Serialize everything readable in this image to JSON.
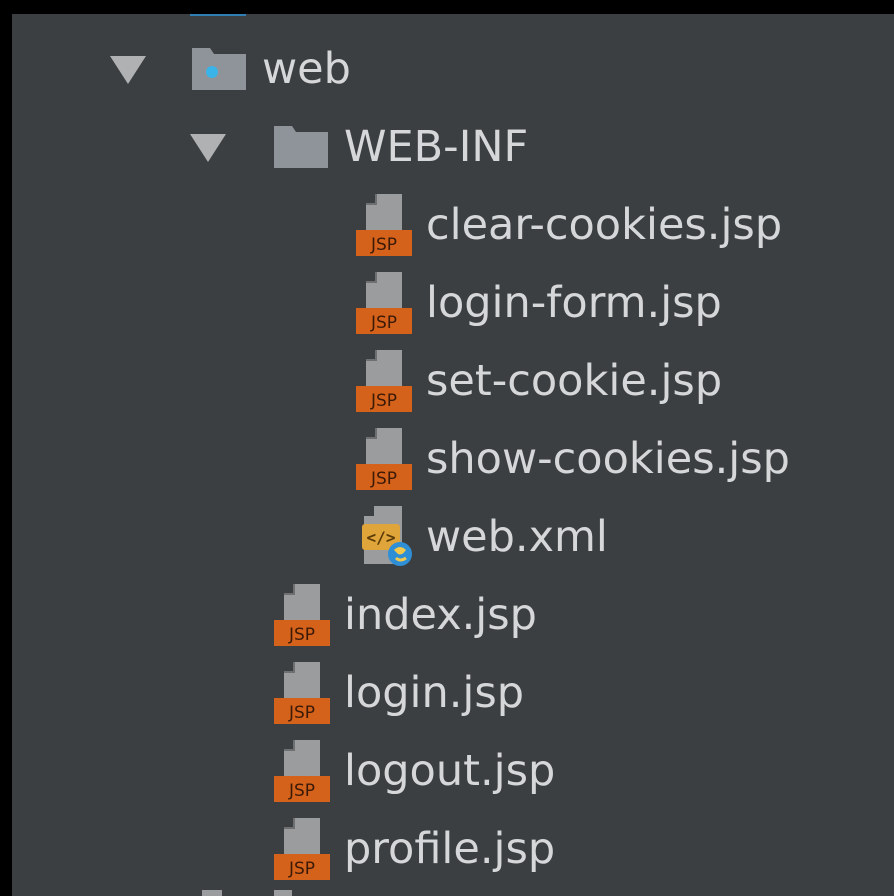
{
  "tree": {
    "nodes": [
      {
        "label": "web",
        "type": "web-folder",
        "expanded": true,
        "depth": 0
      },
      {
        "label": "WEB-INF",
        "type": "folder",
        "expanded": true,
        "depth": 1
      },
      {
        "label": "clear-cookies.jsp",
        "type": "jsp",
        "depth": 2
      },
      {
        "label": "login-form.jsp",
        "type": "jsp",
        "depth": 2
      },
      {
        "label": "set-cookie.jsp",
        "type": "jsp",
        "depth": 2
      },
      {
        "label": "show-cookies.jsp",
        "type": "jsp",
        "depth": 2
      },
      {
        "label": "web.xml",
        "type": "xml",
        "depth": 2
      },
      {
        "label": "index.jsp",
        "type": "jsp",
        "depth": 1
      },
      {
        "label": "login.jsp",
        "type": "jsp",
        "depth": 1
      },
      {
        "label": "logout.jsp",
        "type": "jsp",
        "depth": 1
      },
      {
        "label": "profile.jsp",
        "type": "jsp",
        "depth": 1
      }
    ],
    "jsp_badge": "JSP"
  },
  "colors": {
    "panel": "#3c3f41",
    "text": "#d5d7d9",
    "folder": "#8e9499",
    "jsp_badge": "#d4621b",
    "web_dot": "#3ab4e8"
  }
}
